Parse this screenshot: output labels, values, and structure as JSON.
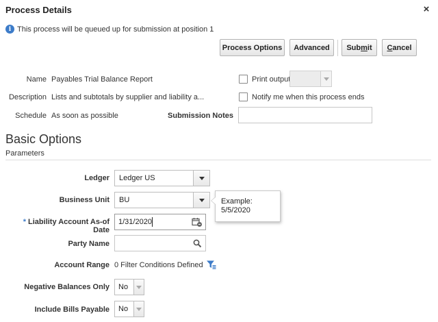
{
  "dialog": {
    "title": "Process Details",
    "close_label": "×",
    "info_message": "This process will be queued up for submission at position 1"
  },
  "toolbar": {
    "process_options": "Process Options",
    "advanced": "Advanced",
    "submit_pre": "Sub",
    "submit_u": "m",
    "submit_post": "it",
    "cancel_u": "C",
    "cancel_post": "ancel"
  },
  "details": {
    "name_label": "Name",
    "name_value": "Payables Trial Balance Report",
    "description_label": "Description",
    "description_value": "Lists and subtotals by supplier and liability a...",
    "schedule_label": "Schedule",
    "schedule_value": "As soon as possible",
    "submission_notes_label": "Submission Notes",
    "submission_notes_value": "",
    "print_output_label": "Print output",
    "notify_label": "Notify me when this process ends"
  },
  "basic_options": {
    "heading": "Basic Options",
    "parameters_label": "Parameters"
  },
  "parameters": {
    "ledger_label": "Ledger",
    "ledger_value": "Ledger US",
    "business_unit_label": "Business Unit",
    "business_unit_value": "BU",
    "required_marker": "*",
    "liability_date_label": "Liability Account As-of Date",
    "liability_date_value": "1/31/2020",
    "party_name_label": "Party Name",
    "party_name_value": "",
    "account_range_label": "Account Range",
    "account_range_value": "0 Filter Conditions Defined",
    "negative_balances_label": "Negative Balances Only",
    "negative_balances_value": "No",
    "include_bills_label": "Include Bills Payable",
    "include_bills_value": "No"
  },
  "tooltip": {
    "line1": "Example:",
    "line2": "5/5/2020"
  },
  "colors": {
    "accent_blue": "#3d7cc9",
    "border": "#c6c6c6"
  },
  "icons": {
    "info": "info-icon",
    "close": "close-icon",
    "calendar": "calendar-icon",
    "search": "search-icon",
    "filter": "filter-icon"
  }
}
